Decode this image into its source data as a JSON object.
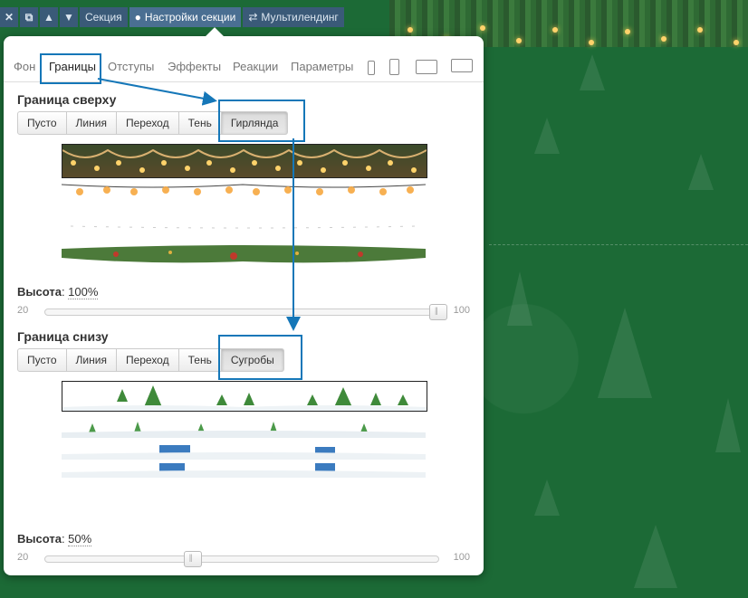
{
  "toolbar": {
    "close_icon": "close-icon",
    "copy_icon": "copy-icon",
    "up_icon": "chevron-up-icon",
    "down_icon": "chevron-down-icon",
    "section_label": "Секция",
    "settings_label": "Настройки секции",
    "multilanding_label": "Мультилендинг"
  },
  "tabs": {
    "items": [
      "Фон",
      "Границы",
      "Отступы",
      "Эффекты",
      "Реакции",
      "Параметры"
    ],
    "active": "Границы"
  },
  "top_border": {
    "title": "Граница сверху",
    "buttons": [
      "Пусто",
      "Линия",
      "Переход",
      "Тень",
      "Гирлянда"
    ],
    "active": "Гирлянда",
    "height_label": "Высота",
    "height_value": "100%",
    "height_fraction": 1.0,
    "slider_min": "20",
    "slider_max": "100"
  },
  "bottom_border": {
    "title": "Граница снизу",
    "buttons": [
      "Пусто",
      "Линия",
      "Переход",
      "Тень",
      "Сугробы"
    ],
    "active": "Сугробы",
    "height_label": "Высота",
    "height_value": "50%",
    "height_fraction": 0.375,
    "slider_min": "20",
    "slider_max": "100"
  },
  "colors": {
    "accent_annotation": "#1577b8",
    "toolbar_bg": "#3a5a78",
    "page_bg": "#1c6a36"
  }
}
